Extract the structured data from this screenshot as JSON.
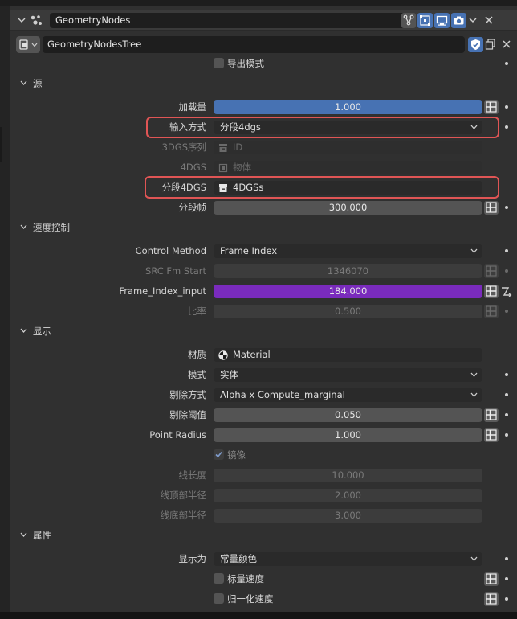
{
  "modifier": {
    "name": "GeometryNodes",
    "tree_name": "GeometryNodesTree",
    "icons": [
      "node-tree-icon",
      "editmode-icon",
      "realtime-icon",
      "render-icon",
      "chevron-down-icon",
      "close-icon"
    ]
  },
  "export_mode": {
    "label": "导出模式",
    "checked": false
  },
  "sections": {
    "source": "源",
    "speed": "速度控制",
    "display": "显示",
    "attributes": "属性"
  },
  "source": {
    "load_amount": {
      "label": "加载量",
      "value": "1.000",
      "fraction": 1.0
    },
    "input_method": {
      "label": "输入方式",
      "value": "分段4dgs"
    },
    "dgs3_seq": {
      "label": "3DGS序列",
      "value": "ID"
    },
    "dgs4": {
      "label": "4DGS",
      "value": "物体"
    },
    "seg_4dgs": {
      "label": "分段4DGS",
      "value": "4DGSs"
    },
    "seg_frame": {
      "label": "分段帧",
      "value": "300.000"
    }
  },
  "speed": {
    "control_method": {
      "label": "Control Method",
      "value": "Frame Index"
    },
    "src_fm_start": {
      "label": "SRC Fm Start",
      "value": "1346070"
    },
    "frame_index_input": {
      "label": "Frame_Index_input",
      "value": "184.000"
    },
    "ratio": {
      "label": "比率",
      "value": "0.500"
    }
  },
  "display": {
    "material": {
      "label": "材质",
      "value": "Material"
    },
    "mode": {
      "label": "模式",
      "value": "实体"
    },
    "cull_method": {
      "label": "剔除方式",
      "value": "Alpha x Compute_marginal"
    },
    "cull_threshold": {
      "label": "剔除阈值",
      "value": "0.050"
    },
    "point_radius": {
      "label": "Point Radius",
      "value": "1.000"
    },
    "mirror": {
      "label": "镜像",
      "checked": true
    },
    "line_length": {
      "label": "线长度",
      "value": "10.000"
    },
    "line_top_radius": {
      "label": "线顶部半径",
      "value": "2.000"
    },
    "line_bottom_radius": {
      "label": "线底部半径",
      "value": "3.000"
    }
  },
  "attributes": {
    "display_as": {
      "label": "显示为",
      "value": "常量颜色"
    },
    "scalar_speed": {
      "label": "标量速度",
      "checked": false
    },
    "normalize_speed": {
      "label": "归一化速度",
      "checked": false
    }
  },
  "colors": {
    "panel_bg": "#303030",
    "field_blue": "#4772b3",
    "field_purple": "#7a2bbd",
    "highlight_red": "#e05555"
  }
}
